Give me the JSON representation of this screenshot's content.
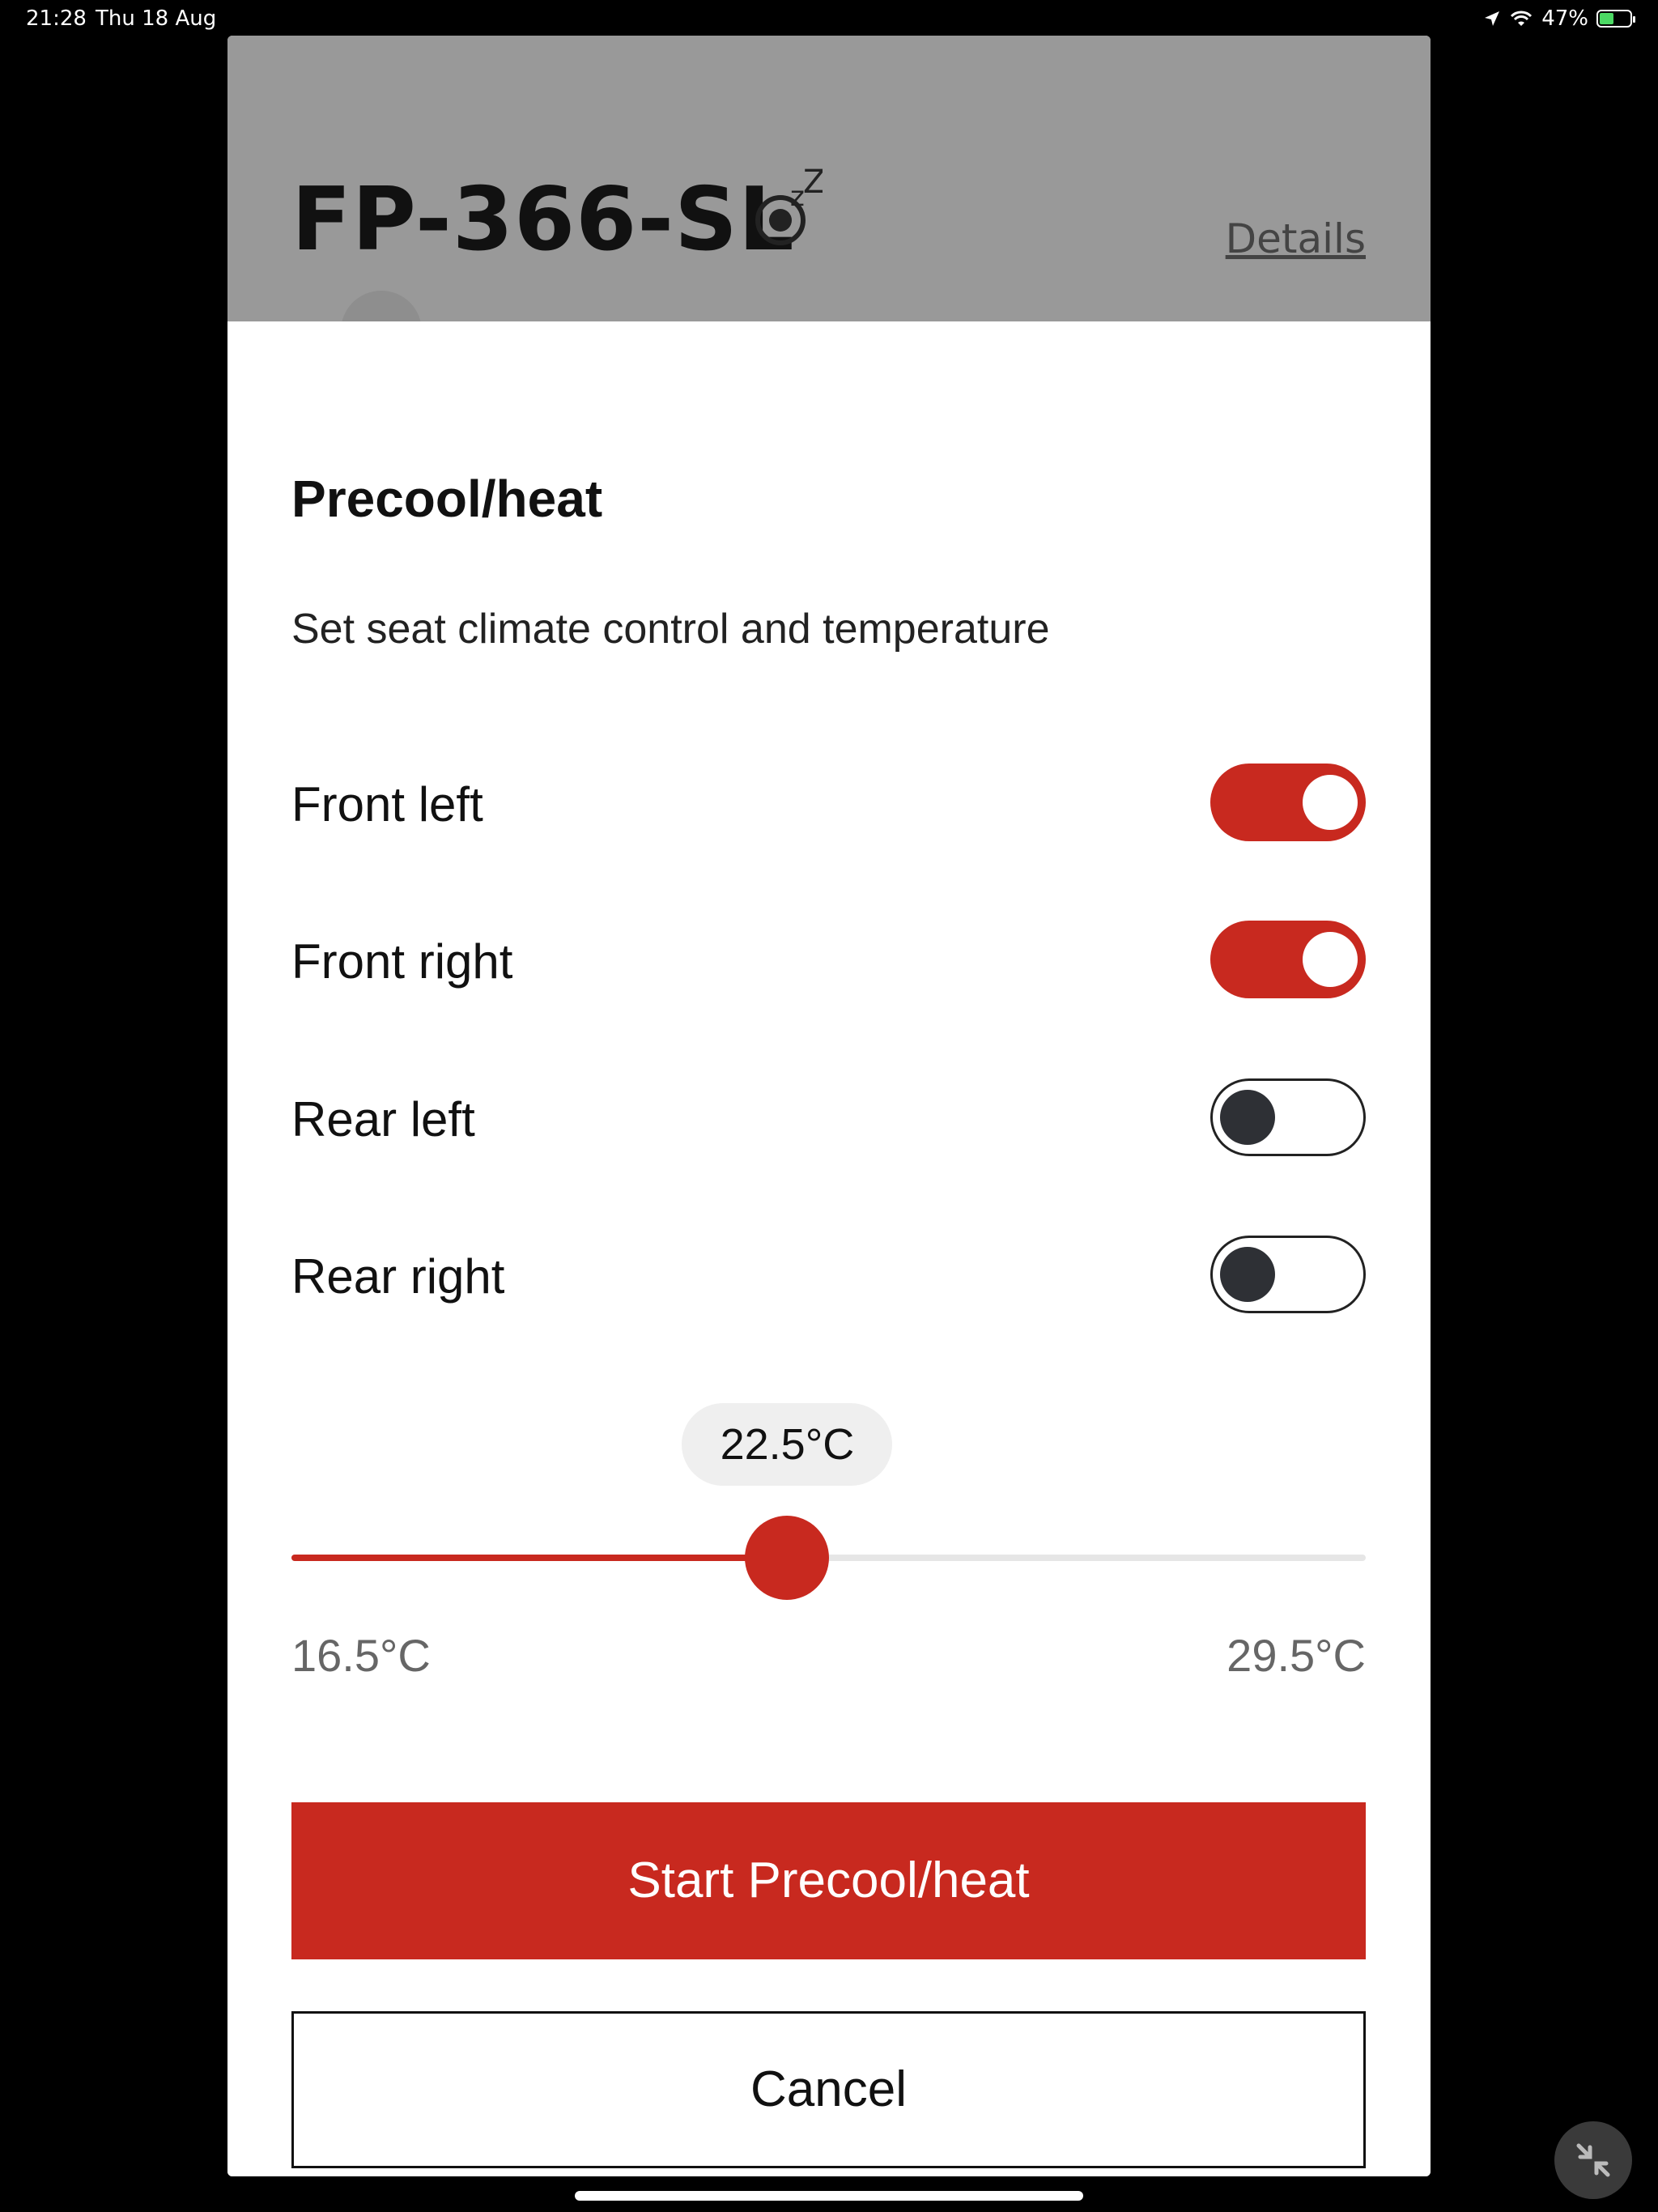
{
  "status_bar": {
    "time": "21:28",
    "date": "Thu 18 Aug",
    "battery": "47%",
    "battery_level": 0.47,
    "icons": [
      "location-arrow-icon",
      "wifi-icon",
      "battery-charging-icon"
    ]
  },
  "vehicle": {
    "plate": "FP-366-SL",
    "status_icon": "sleep-icon",
    "details_label": "Details"
  },
  "sheet": {
    "title": "Precool/heat",
    "subtitle": "Set seat climate control and temperature",
    "seats": [
      {
        "label": "Front left",
        "on": true
      },
      {
        "label": "Front right",
        "on": true
      },
      {
        "label": "Rear left",
        "on": false
      },
      {
        "label": "Rear right",
        "on": false
      }
    ],
    "temperature": {
      "value": 22.5,
      "display": "22.5°C",
      "min": 16.5,
      "min_label": "16.5°C",
      "max": 29.5,
      "max_label": "29.5°C"
    },
    "start_label": "Start Precool/heat",
    "cancel_label": "Cancel"
  },
  "colors": {
    "accent": "#c8291f",
    "header_bg": "#999999",
    "toggle_off_knob": "#2e3035"
  }
}
